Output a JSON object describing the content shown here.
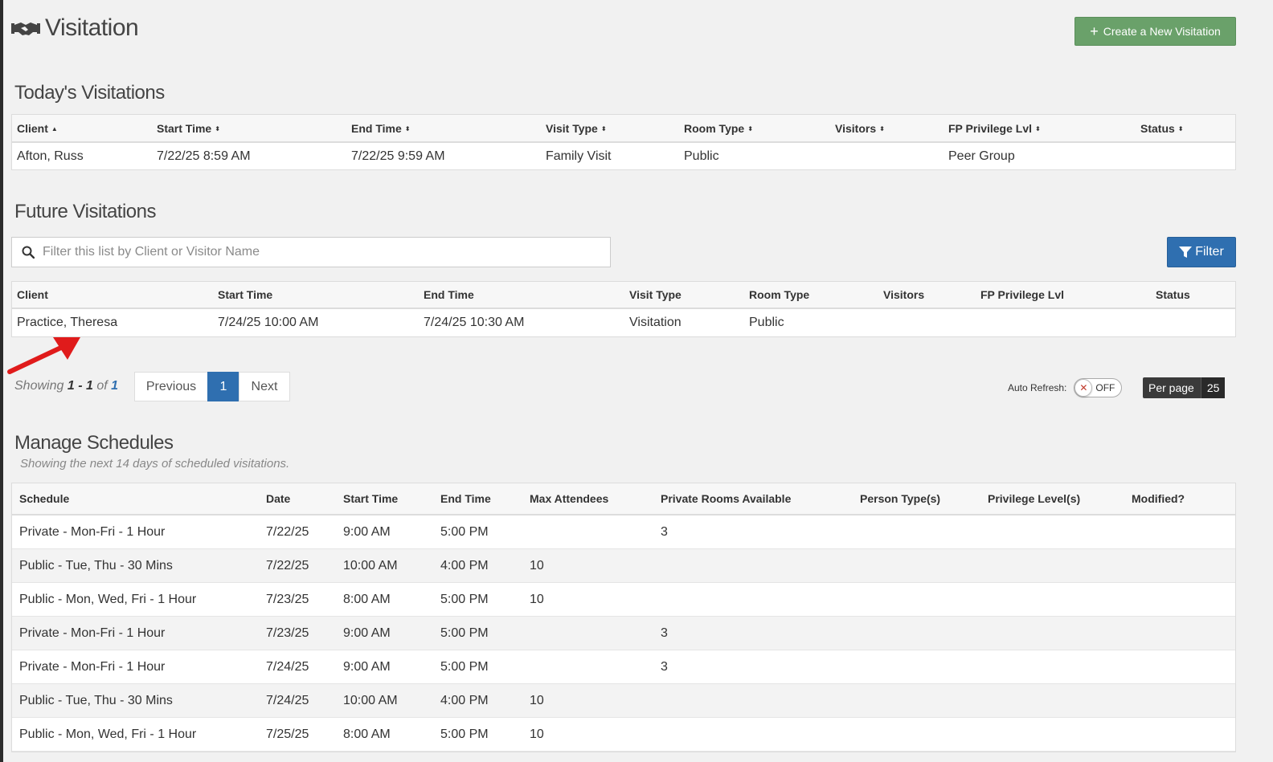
{
  "header": {
    "title": "Visitation",
    "title_icon": "handshake-icon",
    "create_button": "Create a New Visitation"
  },
  "today": {
    "title": "Today's Visitations",
    "columns": [
      "Client",
      "Start Time",
      "End Time",
      "Visit Type",
      "Room Type",
      "Visitors",
      "FP Privilege Lvl",
      "Status"
    ],
    "rows": [
      [
        "Afton, Russ",
        "7/22/25 8:59 AM",
        "7/22/25 9:59 AM",
        "Family Visit",
        "Public",
        "",
        "Peer Group",
        ""
      ]
    ]
  },
  "future": {
    "title": "Future Visitations",
    "search_placeholder": "Filter this list by Client or Visitor Name",
    "filter_button": "Filter",
    "columns": [
      "Client",
      "Start Time",
      "End Time",
      "Visit Type",
      "Room Type",
      "Visitors",
      "FP Privilege Lvl",
      "Status"
    ],
    "rows": [
      [
        "Practice, Theresa",
        "7/24/25 10:00 AM",
        "7/24/25 10:30 AM",
        "Visitation",
        "Public",
        "",
        "",
        ""
      ]
    ],
    "showing": {
      "prefix": "Showing",
      "from": "1",
      "sep": "-",
      "to": "1",
      "of": "of",
      "total": "1"
    },
    "pagination": {
      "previous": "Previous",
      "current": "1",
      "next": "Next"
    },
    "auto_refresh": {
      "label": "Auto Refresh:",
      "state": "OFF"
    },
    "per_page": {
      "label": "Per page",
      "value": "25"
    }
  },
  "schedules": {
    "title": "Manage Schedules",
    "subtitle": "Showing the next 14 days of scheduled visitations.",
    "columns": [
      "Schedule",
      "Date",
      "Start Time",
      "End Time",
      "Max Attendees",
      "Private Rooms Available",
      "Person Type(s)",
      "Privilege Level(s)",
      "Modified?"
    ],
    "rows": [
      [
        "Private - Mon-Fri - 1 Hour",
        "7/22/25",
        "9:00 AM",
        "5:00 PM",
        "",
        "3",
        "",
        "",
        ""
      ],
      [
        "Public - Tue, Thu - 30 Mins",
        "7/22/25",
        "10:00 AM",
        "4:00 PM",
        "10",
        "",
        "",
        "",
        ""
      ],
      [
        "Public - Mon, Wed, Fri - 1 Hour",
        "7/23/25",
        "8:00 AM",
        "5:00 PM",
        "10",
        "",
        "",
        "",
        ""
      ],
      [
        "Private - Mon-Fri - 1 Hour",
        "7/23/25",
        "9:00 AM",
        "5:00 PM",
        "",
        "3",
        "",
        "",
        ""
      ],
      [
        "Private - Mon-Fri - 1 Hour",
        "7/24/25",
        "9:00 AM",
        "5:00 PM",
        "",
        "3",
        "",
        "",
        ""
      ],
      [
        "Public - Tue, Thu - 30 Mins",
        "7/24/25",
        "10:00 AM",
        "4:00 PM",
        "10",
        "",
        "",
        "",
        ""
      ],
      [
        "Public - Mon, Wed, Fri - 1 Hour",
        "7/25/25",
        "8:00 AM",
        "5:00 PM",
        "10",
        "",
        "",
        "",
        ""
      ]
    ]
  },
  "colors": {
    "create_button": "#6aa16a",
    "primary_blue": "#2f6fb0",
    "annotation_arrow": "#e01b1b"
  },
  "annotation": "red-arrow-icon"
}
